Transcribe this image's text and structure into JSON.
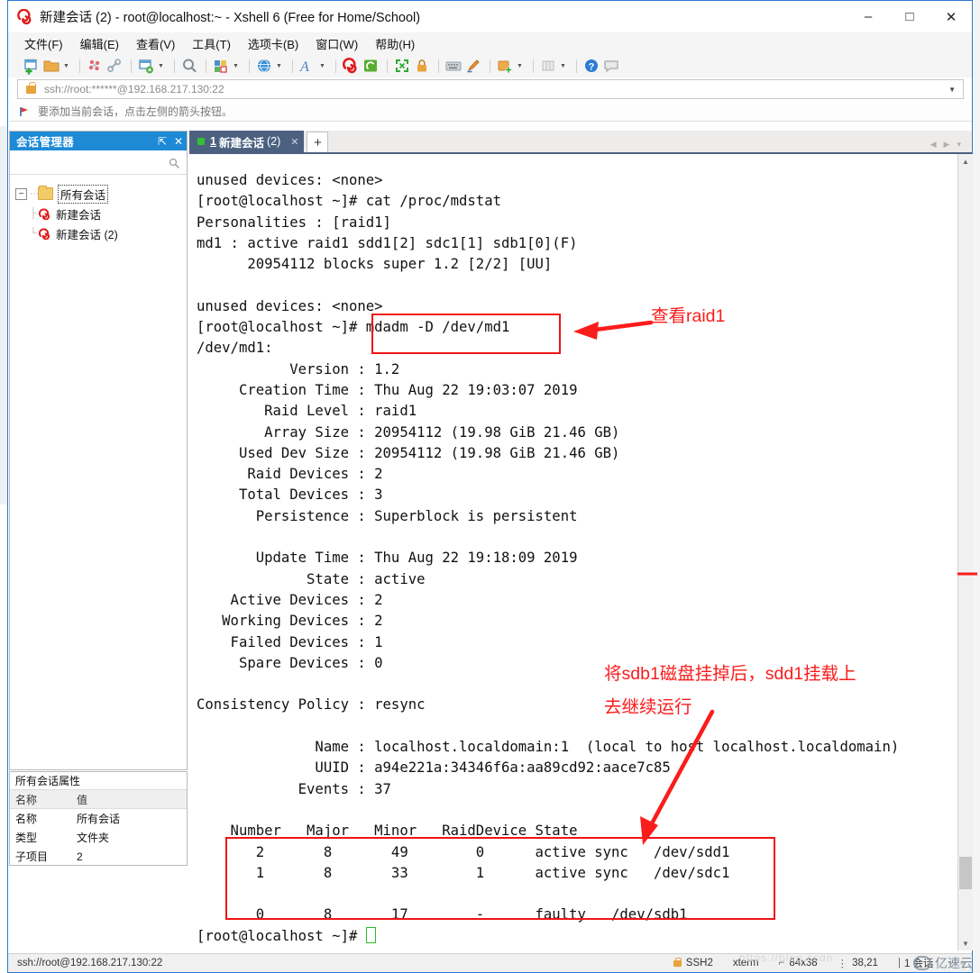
{
  "window": {
    "title": "新建会话 (2) - root@localhost:~ - Xshell 6 (Free for Home/School)",
    "icon": "xshell-logo-icon",
    "minimize": "–",
    "maximize": "□",
    "close": "✕"
  },
  "menubar": {
    "items": [
      {
        "label": "文件(F)",
        "name": "menu-file"
      },
      {
        "label": "编辑(E)",
        "name": "menu-edit"
      },
      {
        "label": "查看(V)",
        "name": "menu-view"
      },
      {
        "label": "工具(T)",
        "name": "menu-tools"
      },
      {
        "label": "选项卡(B)",
        "name": "menu-tabs"
      },
      {
        "label": "窗口(W)",
        "name": "menu-window"
      },
      {
        "label": "帮助(H)",
        "name": "menu-help"
      }
    ]
  },
  "toolbar": {
    "icons": [
      "new-session-icon",
      "open-folder-icon",
      "caret-down-icon",
      "sep",
      "disconnect-icon",
      "link-icon",
      "sep",
      "session-properties-icon",
      "caret-down-icon",
      "sep",
      "find-icon",
      "sep",
      "layout-icon",
      "caret-down-icon",
      "sep",
      "globe-icon",
      "caret-down-icon",
      "sep",
      "font-icon",
      "caret-down-icon",
      "sep",
      "xshell-icon",
      "xftp-icon",
      "sep",
      "fullscreen-icon",
      "lock-icon",
      "sep",
      "keyboard-icon",
      "highlight-pen-icon",
      "sep",
      "add-toolbar-icon",
      "caret-down-icon",
      "sep",
      "columns-icon",
      "caret-down-icon",
      "sep",
      "help-icon",
      "comment-icon"
    ]
  },
  "address": {
    "value": "ssh://root:******@192.168.217.130:22",
    "lock_icon": "lock-icon",
    "dropdown_icon": "caret-down-icon"
  },
  "info_strip": {
    "icon": "red-flag-icon",
    "text": "要添加当前会话，点击左侧的箭头按钮。"
  },
  "session_manager": {
    "title": "会话管理器",
    "pin_icon": "pin-icon",
    "close_icon": "close-icon",
    "search_placeholder": "",
    "search_icon": "search-icon",
    "tree": {
      "root": {
        "label": "所有会话",
        "icon": "folder-icon",
        "expander": "−"
      },
      "children": [
        {
          "label": "新建会话",
          "icon": "xshell-session-icon"
        },
        {
          "label": "新建会话 (2)",
          "icon": "xshell-session-icon"
        }
      ]
    }
  },
  "properties": {
    "title": "所有会话属性",
    "headers": [
      "名称",
      "值"
    ],
    "rows": [
      {
        "name": "名称",
        "value": "所有会话"
      },
      {
        "name": "类型",
        "value": "文件夹"
      },
      {
        "name": "子项目",
        "value": "2"
      }
    ]
  },
  "tabs": {
    "items": [
      {
        "num": "1",
        "name": "新建会话",
        "suffix": "(2)",
        "status_icon": "green-square-icon",
        "close_icon": "close-icon"
      }
    ],
    "new_tab_label": "+",
    "nav_prev": "◀",
    "nav_next": "▶",
    "nav_menu": "▾"
  },
  "terminal": {
    "lines": [
      "unused devices: <none>",
      "[root@localhost ~]# cat /proc/mdstat",
      "Personalities : [raid1]",
      "md1 : active raid1 sdd1[2] sdc1[1] sdb1[0](F)",
      "      20954112 blocks super 1.2 [2/2] [UU]",
      "",
      "unused devices: <none>",
      "[root@localhost ~]# mdadm -D /dev/md1",
      "/dev/md1:",
      "           Version : 1.2",
      "     Creation Time : Thu Aug 22 19:03:07 2019",
      "        Raid Level : raid1",
      "        Array Size : 20954112 (19.98 GiB 21.46 GB)",
      "     Used Dev Size : 20954112 (19.98 GiB 21.46 GB)",
      "      Raid Devices : 2",
      "     Total Devices : 3",
      "       Persistence : Superblock is persistent",
      "",
      "       Update Time : Thu Aug 22 19:18:09 2019",
      "             State : active",
      "    Active Devices : 2",
      "   Working Devices : 2",
      "    Failed Devices : 1",
      "     Spare Devices : 0",
      "",
      "Consistency Policy : resync",
      "",
      "              Name : localhost.localdomain:1  (local to host localhost.localdomain)",
      "              UUID : a94e221a:34346f6a:aa89cd92:aace7c85",
      "            Events : 37",
      "",
      "    Number   Major   Minor   RaidDevice State",
      "       2       8       49        0      active sync   /dev/sdd1",
      "       1       8       33        1      active sync   /dev/sdc1",
      "",
      "       0       8       17        -      faulty   /dev/sdb1"
    ],
    "prompt": "[root@localhost ~]# ",
    "cursor": "block-cursor"
  },
  "annotations": [
    {
      "id": "anno-view-raid1",
      "text": "查看raid1",
      "color": "#fb1c1c"
    },
    {
      "id": "anno-sdb1-fail-line1",
      "text": "将sdb1磁盘挂掉后，sdd1挂载上",
      "color": "#fb1c1c"
    },
    {
      "id": "anno-sdb1-fail-line2",
      "text": "去继续运行",
      "color": "#fb1c1c"
    }
  ],
  "status_bar": {
    "connection": "ssh://root@192.168.217.130:22",
    "protocol": "SSH2",
    "terminal_type": "xterm",
    "size": "84x38",
    "cursor_position": "38,21",
    "sessions": "1 会话",
    "watermark_faint": "https://blog.csdn",
    "watermark": "亿速云",
    "lock_icon": "lock-icon",
    "size_icon": "resize-icon",
    "pos_icon": "cursor-pos-icon",
    "session_icon": "session-count-icon"
  },
  "colors": {
    "accent": "#1e8ad6",
    "tab_active": "#4c6180",
    "annotation_red": "#fb1c1c",
    "window_border": "#2b7cd3",
    "cursor_green": "#2dbb2d"
  }
}
